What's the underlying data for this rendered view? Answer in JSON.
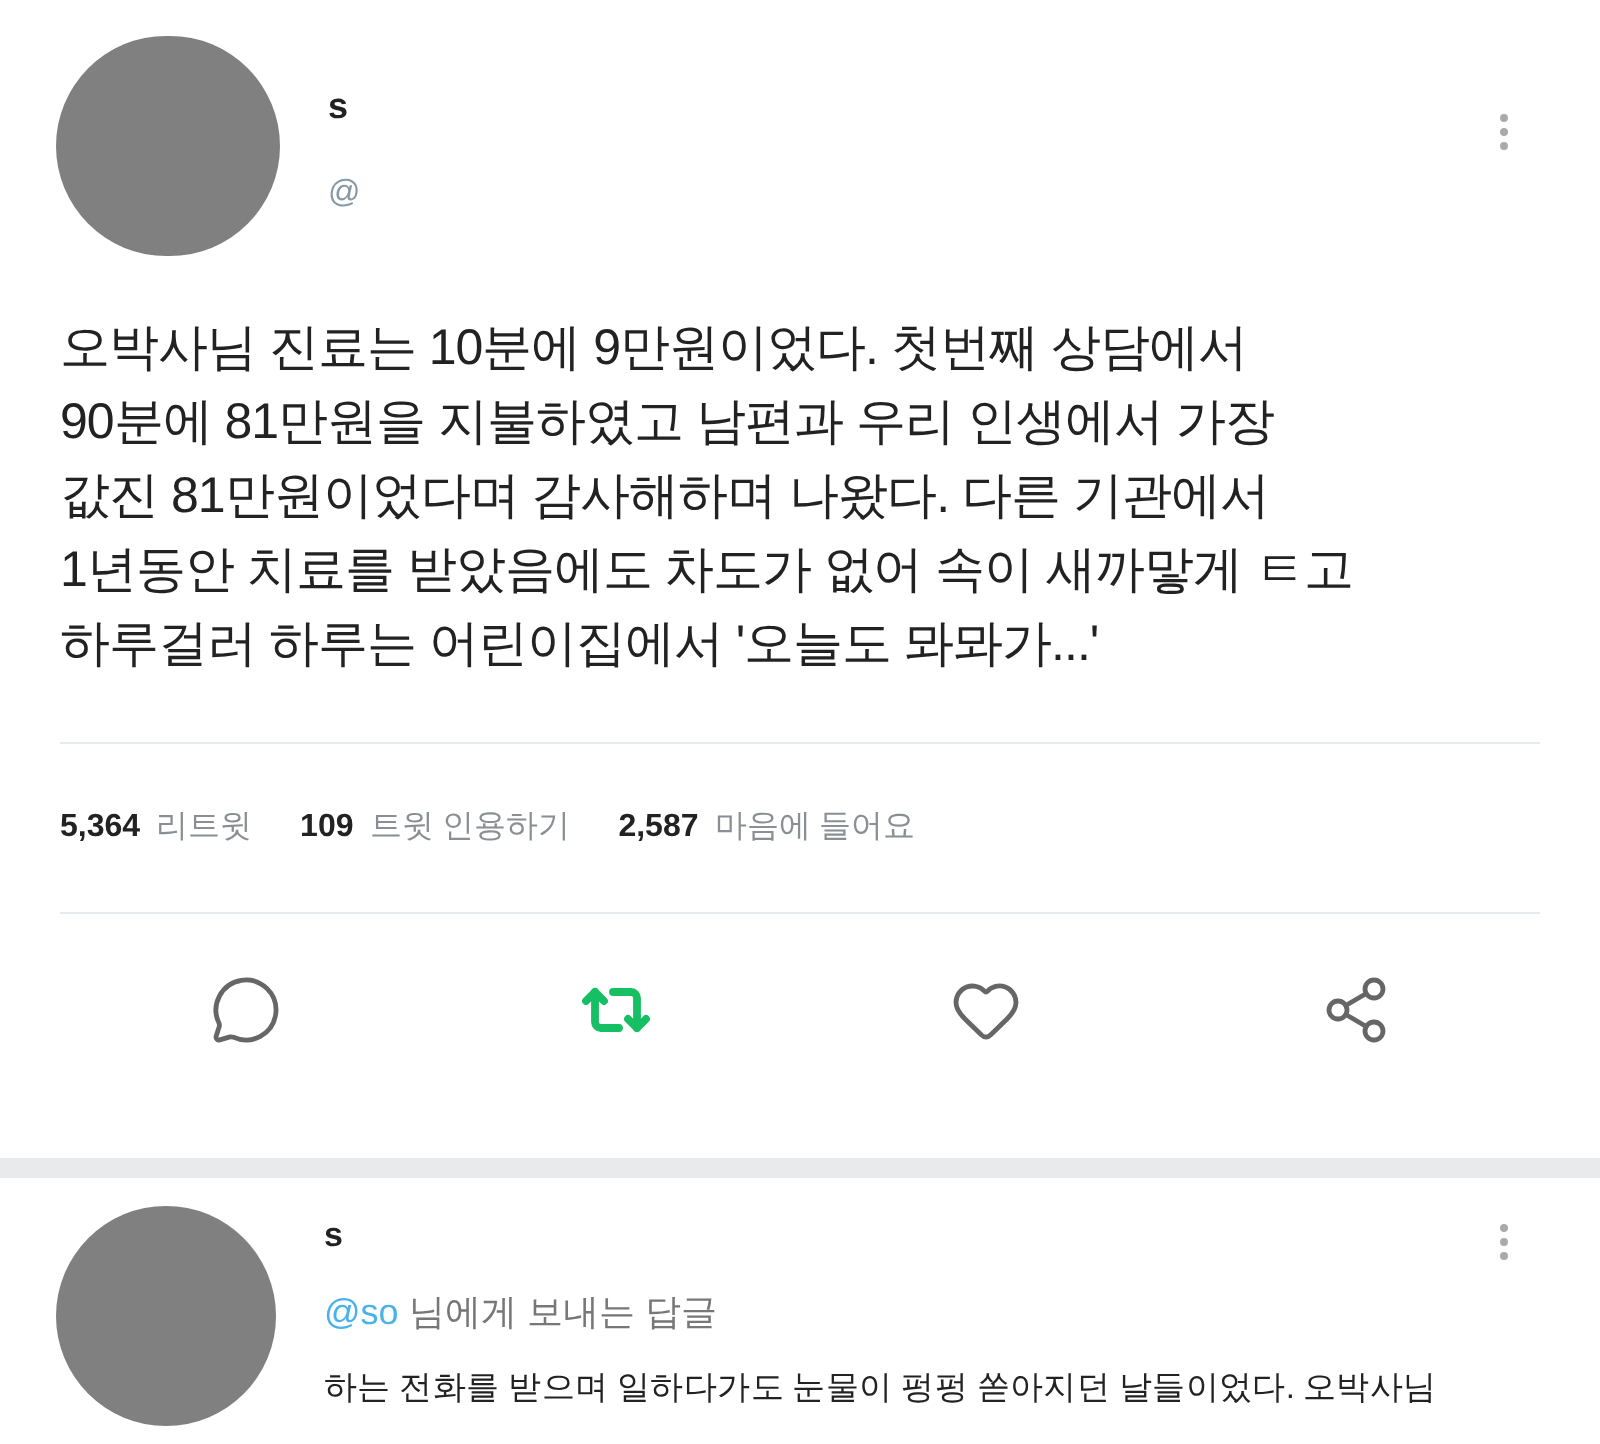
{
  "tweet": {
    "name": "s",
    "handle": "@",
    "lines": [
      "오박사님 진료는 10분에 9만원이었다. 첫번째 상담에서",
      "90분에 81만원을 지불하였고 남편과 우리 인생에서 가장",
      "값진 81만원이었다며 감사해하며 나왔다. 다른 기관에서",
      "1년동안 치료를 받았음에도 차도가 없어 속이 새까맣게 ㅌ고",
      "하루걸러 하루는 어린이집에서 '오늘도 뫄뫄가...'"
    ],
    "stats": [
      {
        "count": "5,364",
        "label": "리트윗"
      },
      {
        "count": "109",
        "label": "트윗 인용하기"
      },
      {
        "count": "2,587",
        "label": "마음에 들어요"
      }
    ],
    "actions": [
      {
        "kind": "reply",
        "selected": false
      },
      {
        "kind": "retweet",
        "selected": true
      },
      {
        "kind": "like",
        "selected": false
      },
      {
        "kind": "share",
        "selected": false
      }
    ]
  },
  "reply": {
    "name": "s",
    "mention": "@so",
    "reply_to": "님에게 보내는 답글",
    "text": "하는 전화를 받으며 일하다가도 눈물이 펑펑 쏟아지던 날들이었다. 오박사님"
  }
}
